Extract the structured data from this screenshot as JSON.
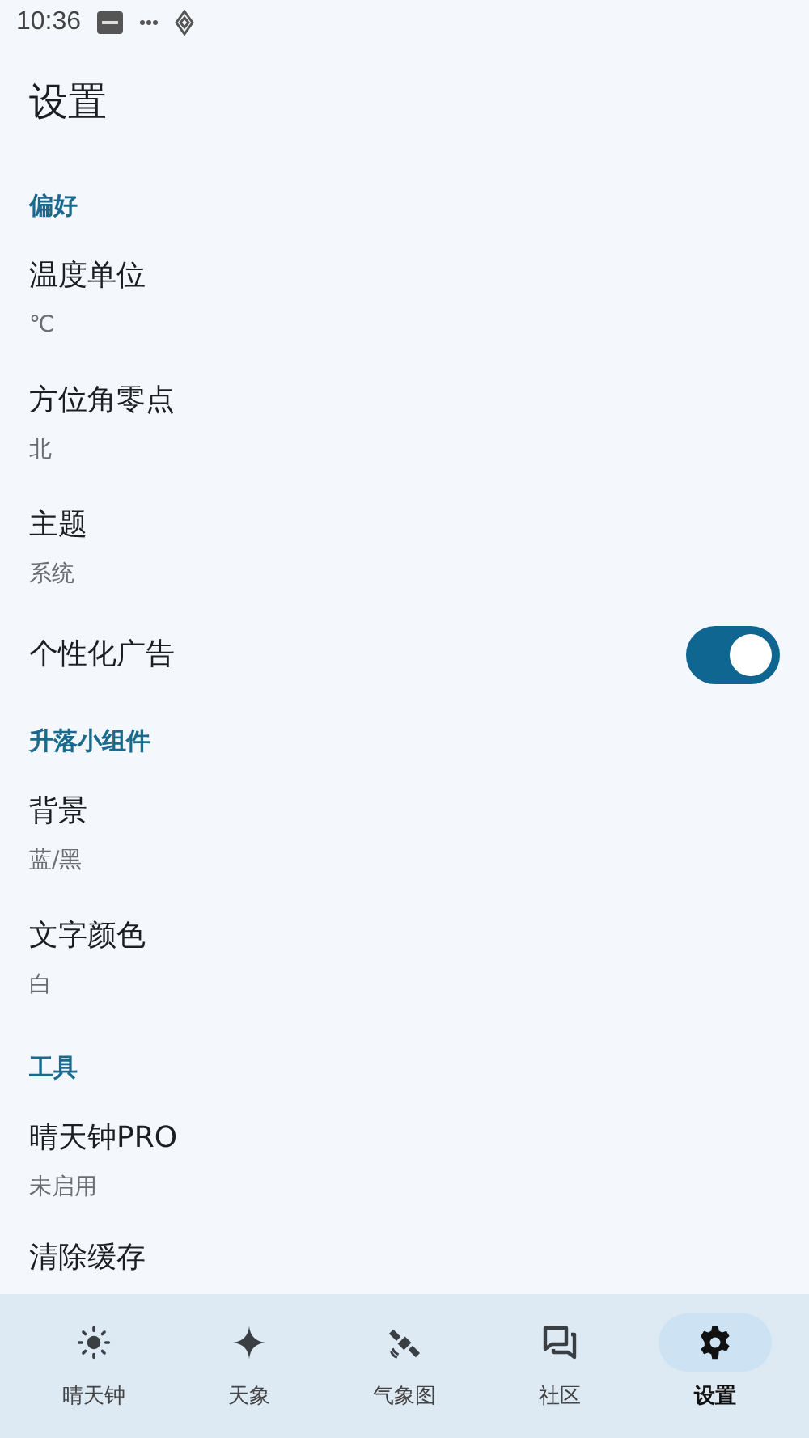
{
  "status_bar": {
    "time": "10:36"
  },
  "title": "设置",
  "sections": [
    {
      "header": "偏好",
      "items": [
        {
          "kind": "value",
          "title": "温度单位",
          "value": "℃"
        },
        {
          "kind": "value",
          "title": "方位角零点",
          "value": "北"
        },
        {
          "kind": "value",
          "title": "主题",
          "value": "系统"
        },
        {
          "kind": "switch",
          "title": "个性化广告",
          "on": true
        }
      ]
    },
    {
      "header": "升落小组件",
      "items": [
        {
          "kind": "value",
          "title": "背景",
          "value": "蓝/黑"
        },
        {
          "kind": "value",
          "title": "文字颜色",
          "value": "白"
        }
      ]
    },
    {
      "header": "工具",
      "items": [
        {
          "kind": "value",
          "title": "晴天钟PRO",
          "value": "未启用"
        },
        {
          "kind": "plain",
          "title": "清除缓存"
        }
      ]
    }
  ],
  "nav": [
    {
      "label": "晴天钟",
      "selected": false
    },
    {
      "label": "天象",
      "selected": false
    },
    {
      "label": "气象图",
      "selected": false
    },
    {
      "label": "社区",
      "selected": false
    },
    {
      "label": "设置",
      "selected": true
    }
  ]
}
